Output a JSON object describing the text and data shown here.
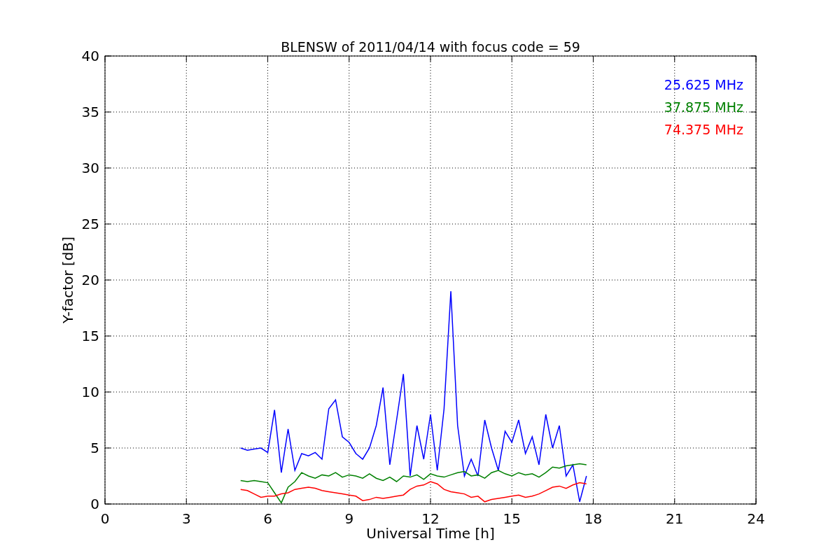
{
  "chart_data": {
    "type": "line",
    "grid": true,
    "title": "BLENSW of 2011/04/14 with focus code = 59",
    "xlabel": "Universal Time [h]",
    "ylabel": "Y-factor [dB]",
    "xlim": [
      0,
      24
    ],
    "ylim": [
      0,
      40
    ],
    "xticks": [
      0,
      3,
      6,
      9,
      12,
      15,
      18,
      21,
      24
    ],
    "yticks": [
      0,
      5,
      10,
      15,
      20,
      25,
      30,
      35,
      40
    ],
    "x": [
      5,
      5.25,
      5.5,
      5.75,
      6,
      6.25,
      6.5,
      6.75,
      7,
      7.25,
      7.5,
      7.75,
      8,
      8.25,
      8.5,
      8.75,
      9,
      9.25,
      9.5,
      9.75,
      10,
      10.25,
      10.5,
      10.75,
      11,
      11.25,
      11.5,
      11.75,
      12,
      12.25,
      12.5,
      12.75,
      13,
      13.25,
      13.5,
      13.75,
      14,
      14.25,
      14.5,
      14.75,
      15,
      15.25,
      15.5,
      15.75,
      16,
      16.25,
      16.5,
      16.75,
      17,
      17.25,
      17.5,
      17.75
    ],
    "series": [
      {
        "name": "25.625 MHz",
        "color": "#0000ff",
        "values": [
          5.0,
          4.8,
          4.9,
          5.0,
          4.6,
          8.4,
          2.8,
          6.7,
          3.0,
          4.5,
          4.3,
          4.6,
          4.0,
          8.5,
          9.3,
          6.0,
          5.5,
          4.5,
          4.0,
          5.0,
          7.0,
          10.4,
          3.5,
          7.5,
          11.6,
          2.5,
          7.0,
          4.0,
          8.0,
          3.0,
          8.5,
          19.0,
          7.0,
          2.5,
          4.0,
          2.5,
          7.5,
          5.0,
          3.0,
          6.5,
          5.5,
          7.5,
          4.5,
          6.0,
          3.5,
          8.0,
          5.0,
          7.0,
          2.5,
          3.5,
          0.2,
          2.5
        ]
      },
      {
        "name": "37.875 MHz",
        "color": "#008000",
        "values": [
          2.1,
          2.0,
          2.1,
          2.0,
          1.9,
          1.0,
          0.1,
          1.5,
          2.0,
          2.8,
          2.5,
          2.3,
          2.6,
          2.5,
          2.8,
          2.4,
          2.6,
          2.5,
          2.3,
          2.7,
          2.3,
          2.1,
          2.4,
          2.0,
          2.5,
          2.4,
          2.6,
          2.2,
          2.7,
          2.5,
          2.4,
          2.6,
          2.8,
          2.9,
          2.5,
          2.6,
          2.3,
          2.8,
          3.0,
          2.7,
          2.5,
          2.8,
          2.6,
          2.7,
          2.4,
          2.8,
          3.3,
          3.2,
          3.4,
          3.5,
          3.6,
          3.5
        ]
      },
      {
        "name": "74.375 MHz",
        "color": "#ff0000",
        "values": [
          1.3,
          1.2,
          0.9,
          0.6,
          0.7,
          0.7,
          0.9,
          1.0,
          1.3,
          1.4,
          1.5,
          1.4,
          1.2,
          1.1,
          1.0,
          0.9,
          0.8,
          0.7,
          0.3,
          0.4,
          0.6,
          0.5,
          0.6,
          0.7,
          0.8,
          1.3,
          1.6,
          1.7,
          2.0,
          1.8,
          1.3,
          1.1,
          1.0,
          0.9,
          0.6,
          0.7,
          0.2,
          0.4,
          0.5,
          0.6,
          0.7,
          0.8,
          0.6,
          0.7,
          0.9,
          1.2,
          1.5,
          1.6,
          1.4,
          1.7,
          1.9,
          1.8
        ]
      }
    ]
  }
}
